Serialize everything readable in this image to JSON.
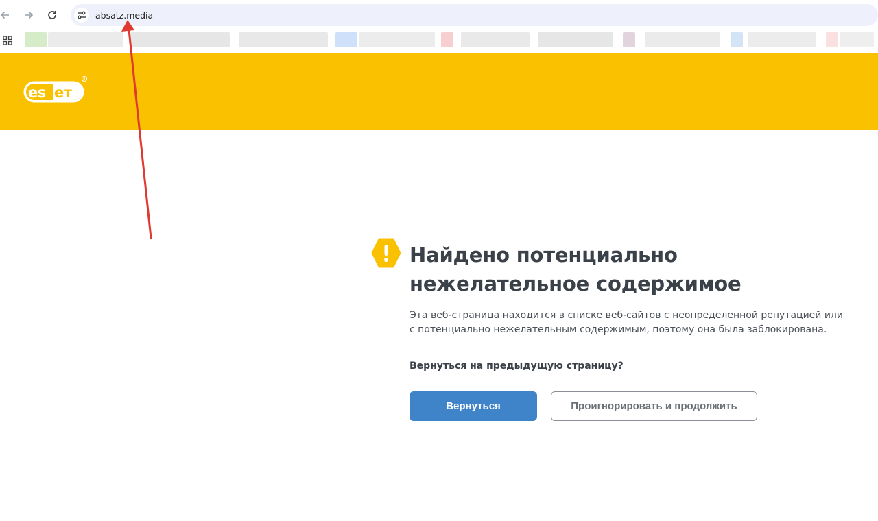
{
  "browser": {
    "url": "absatz.media",
    "icons": {
      "back": "arrow-left-icon",
      "forward": "arrow-right-icon",
      "reload": "reload-icon",
      "site_info": "tune-icon",
      "apps": "apps-grid-icon"
    }
  },
  "banner": {
    "brand": "eset",
    "color": "#fac100"
  },
  "main": {
    "title": "Найдено потенциально нежелательное содержимое",
    "desc_before": "Эта ",
    "desc_link": "веб-страница",
    "desc_after": " находится в списке веб-сайтов с неопределенной репутацией или с потенциально нежелательным содержимым, поэтому она была заблокирована.",
    "question": "Вернуться на предыдущую страницу?",
    "back_button": "Вернуться",
    "ignore_button": "Проигнорировать и продолжить"
  },
  "colors": {
    "accent": "#3f84c8",
    "warning": "#fac100",
    "annotation": "#e0392f"
  }
}
